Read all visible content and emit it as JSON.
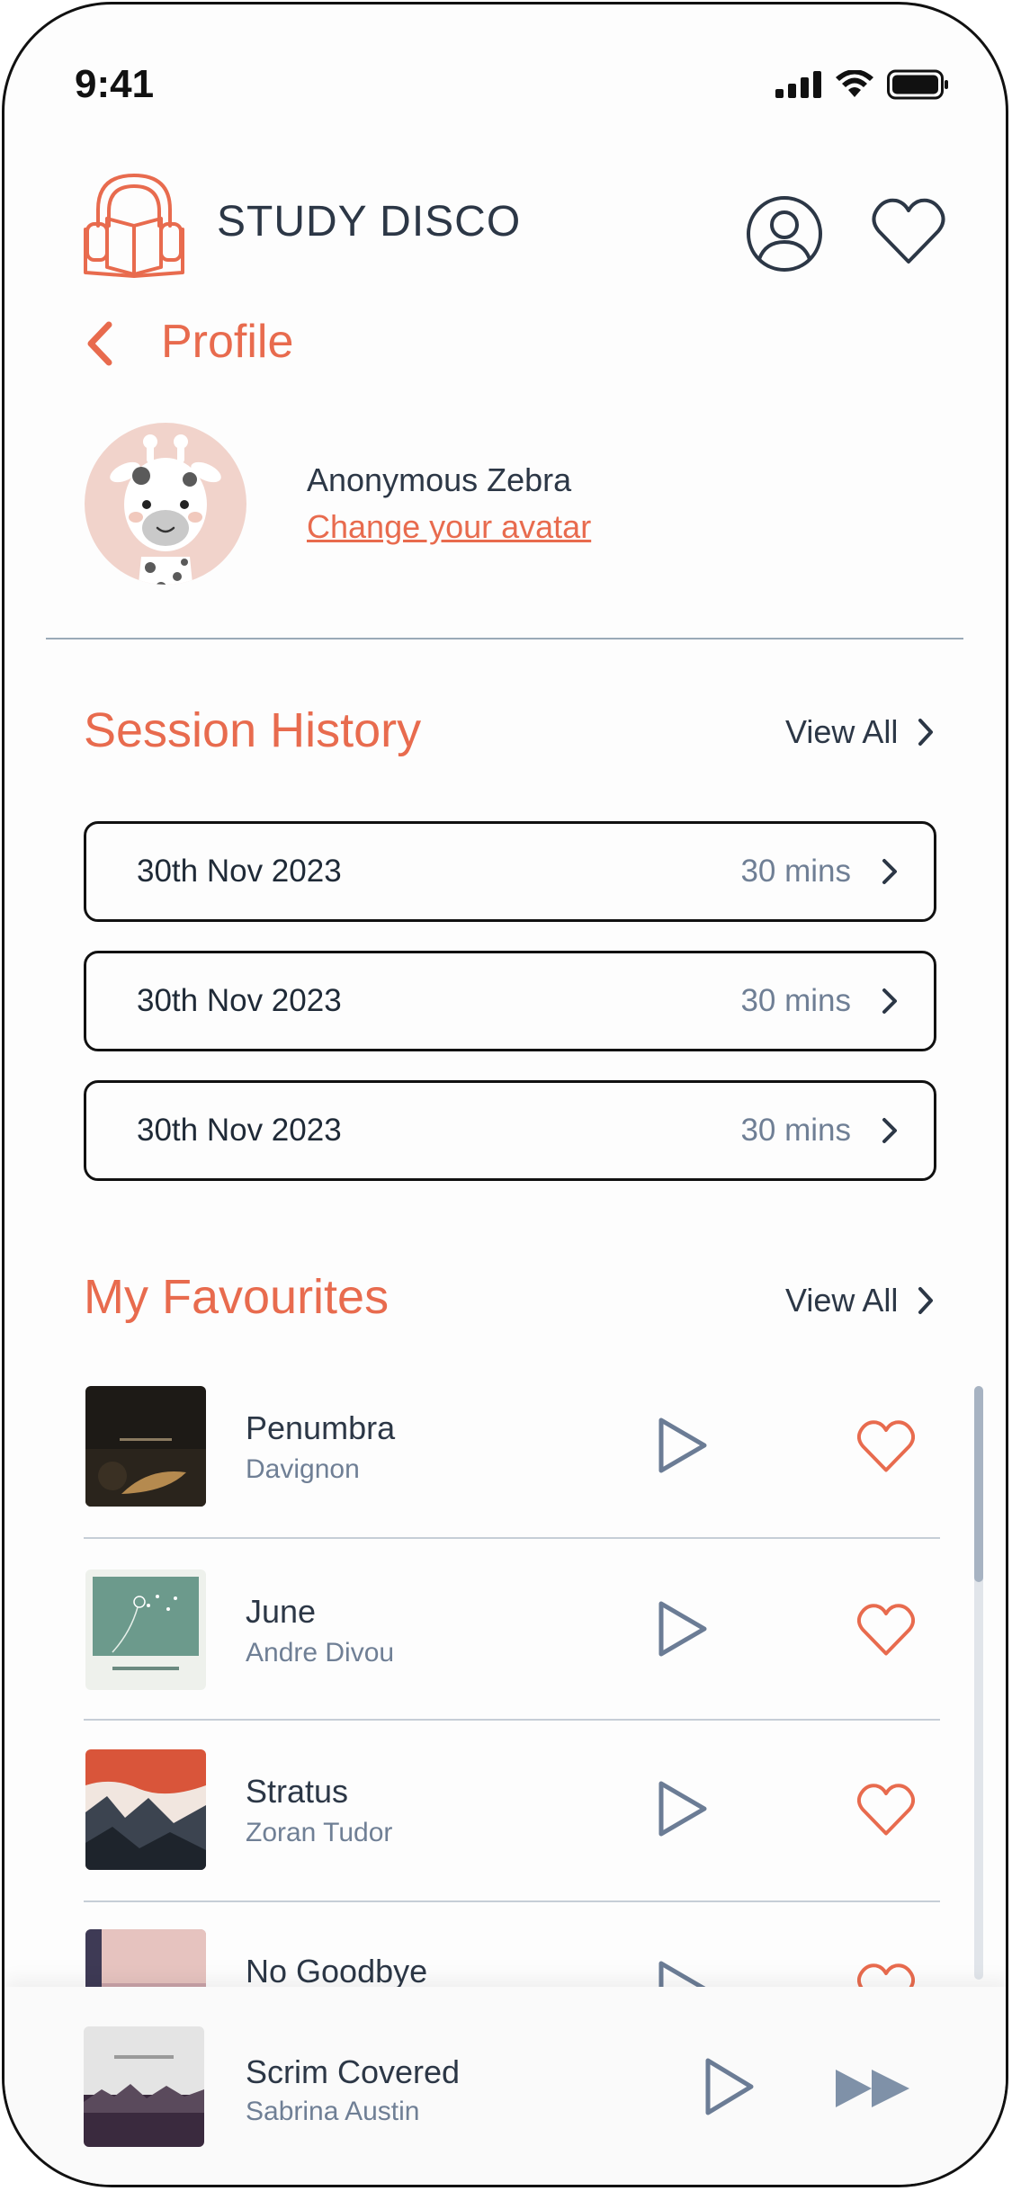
{
  "status_bar": {
    "time": "9:41"
  },
  "brand": {
    "name": "STUDY DISCO"
  },
  "nav": {
    "back_label": "Profile"
  },
  "profile": {
    "name": "Anonymous Zebra",
    "change_avatar": "Change your avatar"
  },
  "session_history": {
    "title": "Session History",
    "view_all": "View All",
    "items": [
      {
        "date": "30th Nov 2023",
        "duration": "30 mins"
      },
      {
        "date": "30th Nov 2023",
        "duration": "30 mins"
      },
      {
        "date": "30th Nov 2023",
        "duration": "30 mins"
      }
    ]
  },
  "favourites": {
    "title": "My Favourites",
    "view_all": "View All",
    "tracks": [
      {
        "title": "Penumbra",
        "artist": "Davignon"
      },
      {
        "title": "June",
        "artist": "Andre Divou"
      },
      {
        "title": "Stratus",
        "artist": "Zoran Tudor"
      },
      {
        "title": "No Goodbye",
        "artist": ""
      }
    ]
  },
  "now_playing": {
    "title": "Scrim Covered",
    "artist": "Sabrina Austin"
  },
  "colors": {
    "accent": "#e86b4e",
    "text": "#2c3746",
    "muted": "#6f7f95",
    "icon": "#6b7c95"
  }
}
